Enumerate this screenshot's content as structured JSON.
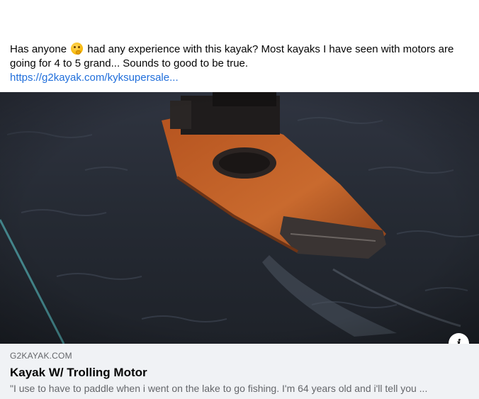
{
  "post": {
    "text_before_emoji": "Has anyone",
    "emoji": "thinking-face-emoji",
    "text_after_emoji": "had any experience with this kayak? Most kayaks I have seen with motors are going for 4 to 5 grand... Sounds to good to be true.",
    "link_text": "https://g2kayak.com/kyksupersale..."
  },
  "media": {
    "image": "kayak-with-trolling-motor-on-water",
    "info_icon": "info-icon"
  },
  "link_card": {
    "domain": "G2KAYAK.COM",
    "title": "Kayak W/ Trolling Motor",
    "description": "\"I use to have to paddle when i went on the lake to go fishing. I'm 64 years old and i'll tell you ..."
  },
  "colors": {
    "link": "#216fdb",
    "card_background": "#f0f2f5",
    "secondary_text": "#65676b",
    "kayak_orange": "#c8662a"
  }
}
